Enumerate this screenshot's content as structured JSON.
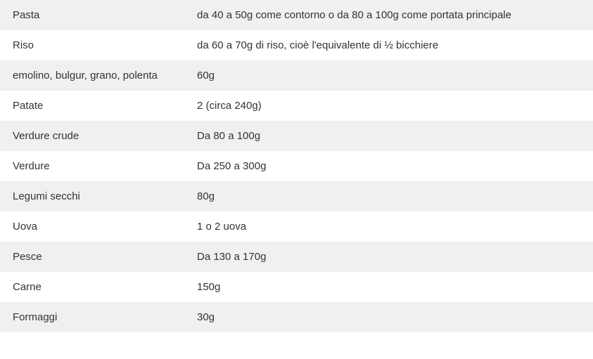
{
  "chart_data": {
    "type": "table",
    "rows": [
      {
        "food": "Pasta",
        "portion": "da 40 a 50g come contorno o da 80 a 100g come portata principale"
      },
      {
        "food": "Riso",
        "portion": "da 60 a 70g di riso, cioè l'equivalente di ½ bicchiere"
      },
      {
        "food": "emolino, bulgur, grano, polenta",
        "portion": "60g"
      },
      {
        "food": "Patate",
        "portion": "2 (circa 240g)"
      },
      {
        "food": "Verdure crude",
        "portion": "Da 80 a 100g"
      },
      {
        "food": "Verdure",
        "portion": "Da 250 a 300g"
      },
      {
        "food": "Legumi secchi",
        "portion": "80g"
      },
      {
        "food": "Uova",
        "portion": "1 o 2 uova"
      },
      {
        "food": "Pesce",
        "portion": "Da 130 a 170g"
      },
      {
        "food": "Carne",
        "portion": "150g"
      },
      {
        "food": "Formaggi",
        "portion": "30g"
      }
    ]
  }
}
